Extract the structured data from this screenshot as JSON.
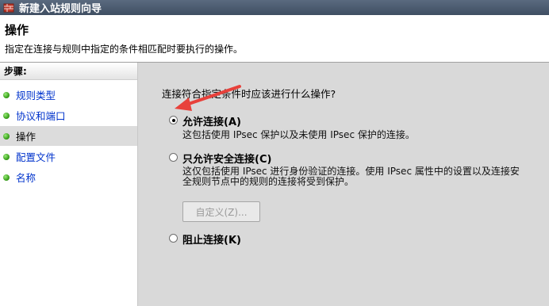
{
  "window": {
    "title": "新建入站规则向导",
    "icon": "firewall-shield-icon"
  },
  "header": {
    "title": "操作",
    "description": "指定在连接与规则中指定的条件相匹配时要执行的操作。"
  },
  "sidebar": {
    "heading": "步骤:",
    "items": [
      {
        "label": "规则类型"
      },
      {
        "label": "协议和端口"
      },
      {
        "label": "操作"
      },
      {
        "label": "配置文件"
      },
      {
        "label": "名称"
      }
    ],
    "active_index": 2
  },
  "main": {
    "question": "连接符合指定条件时应该进行什么操作?",
    "options": [
      {
        "label": "允许连接(A)",
        "description": "这包括使用 IPsec 保护以及未使用 IPsec 保护的连接。",
        "selected": true
      },
      {
        "label": "只允许安全连接(C)",
        "description_line1": "这仅包括使用 IPsec 进行身份验证的连接。使用 IPsec 属性中的设置以及连接安",
        "description_line2": "全规则节点中的规则的连接将受到保护。",
        "selected": false
      },
      {
        "label": "阻止连接(K)",
        "selected": false
      }
    ],
    "customize_button": "自定义(Z)..."
  },
  "colors": {
    "titlebar": "#4a5a6f",
    "link": "#0033cc",
    "content_bg": "#d9d9d9",
    "annotation_arrow": "#e8413b"
  }
}
